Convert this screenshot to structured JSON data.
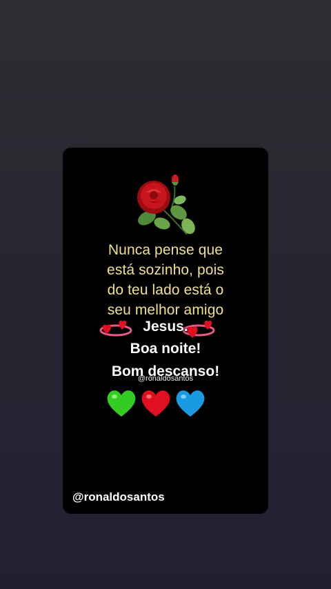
{
  "post": {
    "message_lines": [
      "Nunca pense que",
      "está sozinho, pois",
      "do teu lado está o",
      "seu melhor amigo"
    ],
    "line_jesus": "Jesus.",
    "line_boa_noite": "Boa noite!",
    "line_descanso": "Bom descanso!",
    "watermark_small": "@ronaldosantos",
    "handle": "@ronaldosantos"
  },
  "colors": {
    "message_text": "#f0e08a",
    "heart_green": "#33cc22",
    "heart_red": "#e01020",
    "heart_blue": "#1a9ae0"
  },
  "icons": [
    "rose-icon",
    "sparkling-heart-icon",
    "green-heart-icon",
    "red-heart-icon",
    "blue-heart-icon"
  ]
}
